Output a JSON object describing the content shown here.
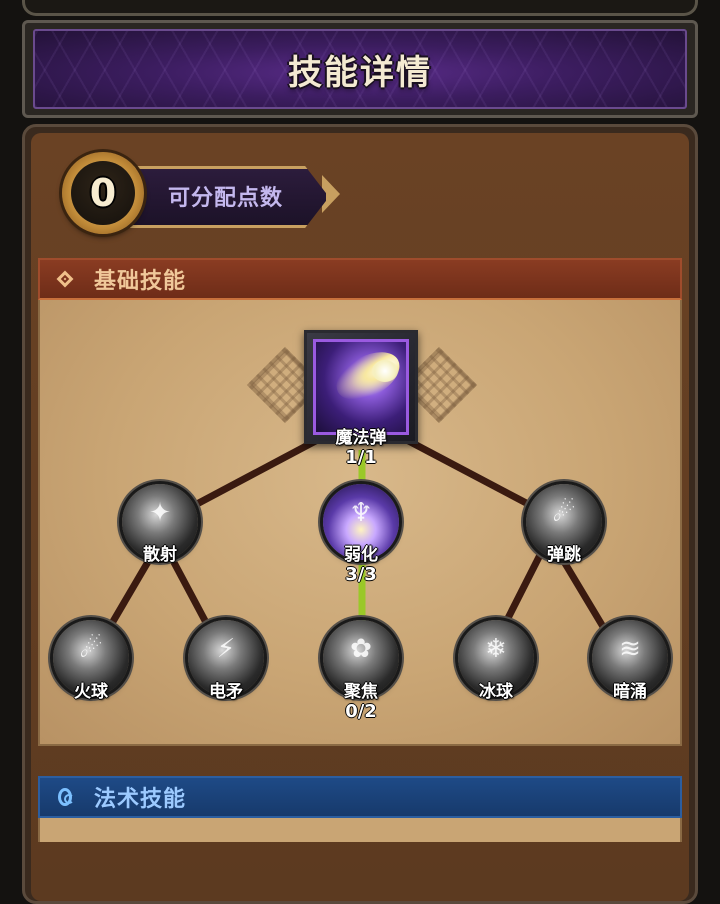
{
  "header": {
    "title": "技能详情"
  },
  "points": {
    "value": "0",
    "label": "可分配点数"
  },
  "sections": {
    "basic": {
      "title": "基础技能",
      "icon": "diamond-icon"
    },
    "spell": {
      "title": "法术技能",
      "icon": "swirl-icon"
    }
  },
  "skills": {
    "root": {
      "name": "魔法弹",
      "level": "1/1",
      "icon": "comet-icon"
    },
    "scatter": {
      "name": "散射",
      "icon": "scatter-icon"
    },
    "weaken": {
      "name": "弱化",
      "level": "3/3",
      "icon": "weaken-icon"
    },
    "bounce": {
      "name": "弹跳",
      "icon": "bounce-icon"
    },
    "fireball": {
      "name": "火球",
      "icon": "fireball-icon"
    },
    "lightning_spear": {
      "name": "电矛",
      "icon": "lightning-spear-icon"
    },
    "focus": {
      "name": "聚焦",
      "level": "0/2",
      "icon": "focus-icon"
    },
    "iceball": {
      "name": "冰球",
      "icon": "iceball-icon"
    },
    "undertow": {
      "name": "暗涌",
      "icon": "undertow-icon"
    }
  },
  "colors": {
    "active_link": "#9ac828",
    "inactive_link": "#3a1a10",
    "root_border": "#9a5ae0",
    "basic_header": "#7a3420",
    "spell_header": "#1a427a"
  }
}
